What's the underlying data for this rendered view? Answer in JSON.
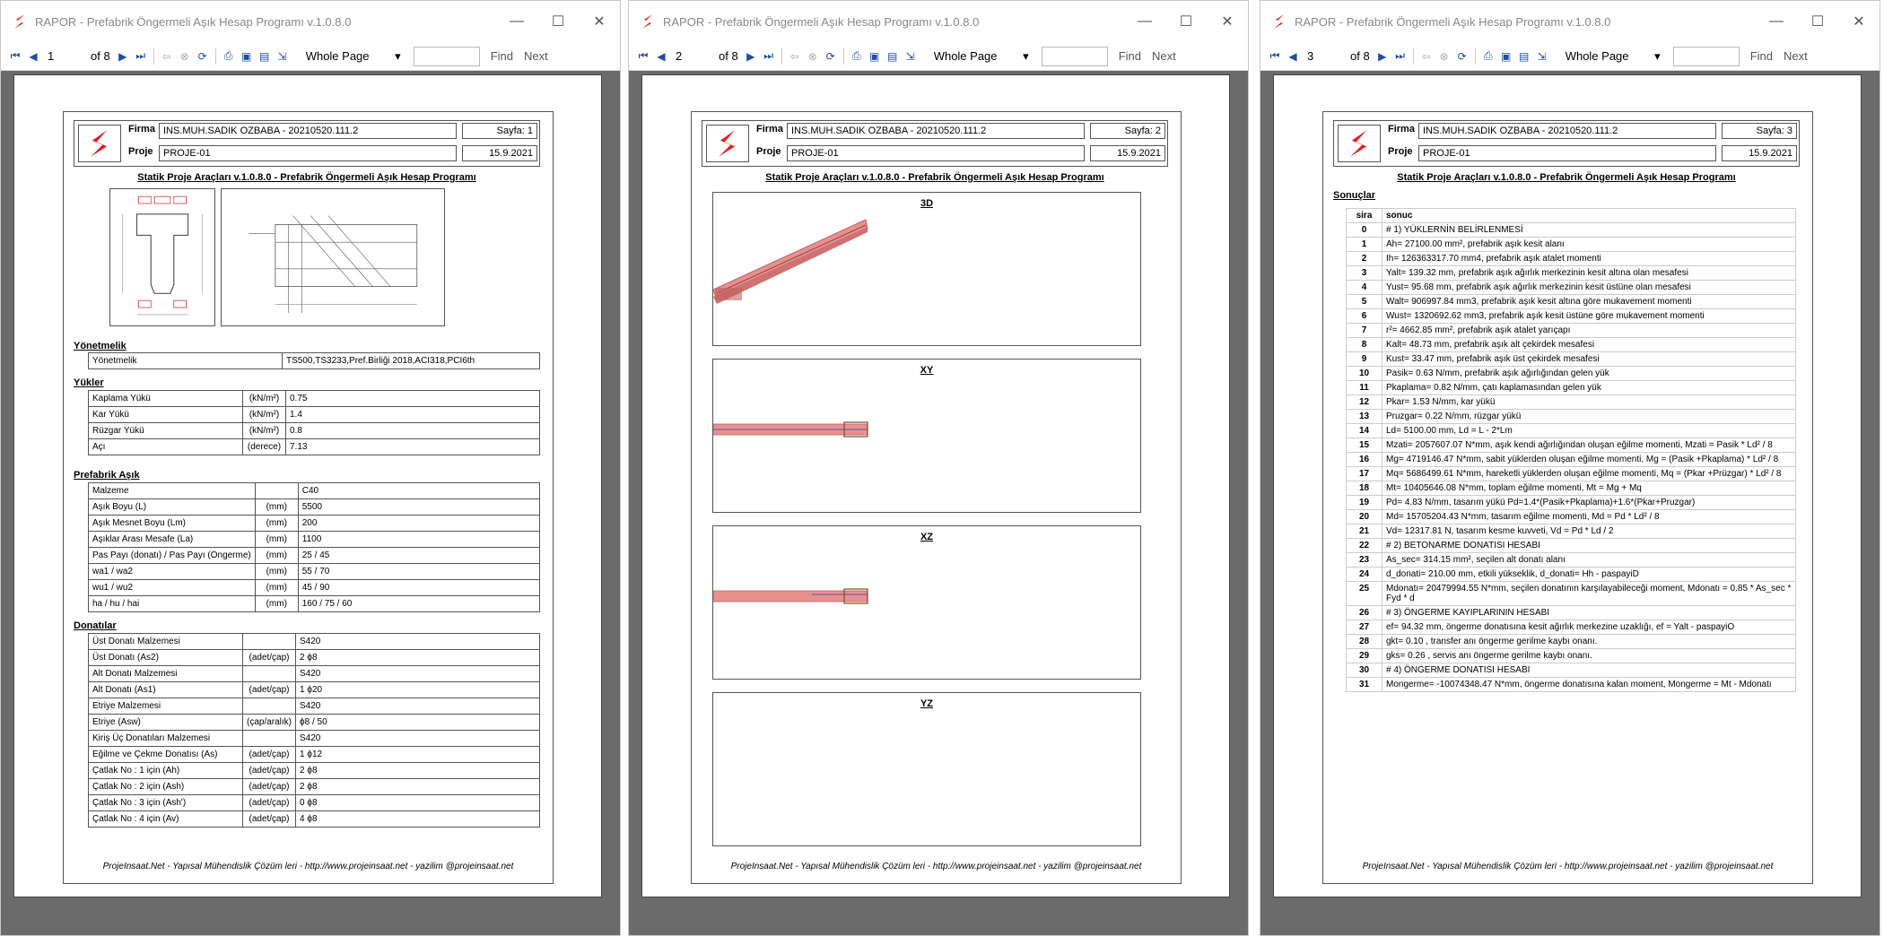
{
  "app_title": "RAPOR - Prefabrik Öngermeli Aşık Hesap Programı v.1.0.8.0",
  "toolbar": {
    "of_label": "of 8",
    "zoom": "Whole Page",
    "find": "Find",
    "next": "Next"
  },
  "pages": [
    "1",
    "2",
    "3"
  ],
  "header": {
    "firma_label": "Firma",
    "proje_label": "Proje",
    "firma_value": "INS.MUH.SADIK OZBABA                    - 20210520.111.2",
    "proje_value": "PROJE-01",
    "date": "15.9.2021",
    "sayfa1": "Sayfa: 1",
    "sayfa2": "Sayfa: 2",
    "sayfa3": "Sayfa: 3"
  },
  "subtitle": "Statik Proje Araçları v.1.0.8.0 - Prefabrik Öngermeli Aşık Hesap Programı",
  "footer": "ProjeInsaat.Net - Yapısal Mühendislik Çözüm leri - http://www.projeinsaat.net - yazilim @projeinsaat.net",
  "page1": {
    "yonetmelik_title": "Yönetmelik",
    "yonetmelik": [
      [
        "Yönetmelik",
        "TS500,TS3233,Pref.Birliği 2018,ACI318,PCI6th"
      ]
    ],
    "yukler_title": "Yükler",
    "yukler": [
      [
        "Kaplama Yükü",
        "(kN/m²)",
        "0.75"
      ],
      [
        "Kar Yükü",
        "(kN/m²)",
        "1.4"
      ],
      [
        "Rüzgar Yükü",
        "(kN/m²)",
        "0.8"
      ],
      [
        "Açı",
        "(derece)",
        "7.13"
      ]
    ],
    "asik_title": "Prefabrik Aşık",
    "asik": [
      [
        "Malzeme",
        "",
        "C40"
      ],
      [
        "Aşık Boyu (L)",
        "(mm)",
        "5500"
      ],
      [
        "Aşık Mesnet Boyu (Lm)",
        "(mm)",
        "200"
      ],
      [
        "Aşıklar Arası Mesafe (La)",
        "(mm)",
        "1100"
      ],
      [
        "Pas Payı (donatı) / Pas Payı (Ongerme)",
        "(mm)",
        "25 / 45"
      ],
      [
        "wa1 / wa2",
        "(mm)",
        "55 / 70"
      ],
      [
        "wu1 / wu2",
        "(mm)",
        "45 / 90"
      ],
      [
        "ha / hu / hai",
        "(mm)",
        "160 / 75 / 60"
      ]
    ],
    "donatilar_title": "Donatılar",
    "donatilar": [
      [
        "Üst Donatı Malzemesi",
        "",
        "S420"
      ],
      [
        "Üst Donatı (As2)",
        "(adet/çap)",
        "2 ϕ8"
      ],
      [
        "Alt Donatı Malzemesi",
        "",
        "S420"
      ],
      [
        "Alt Donatı (As1)",
        "(adet/çap)",
        "1 ϕ20"
      ],
      [
        "Etriye Malzemesi",
        "",
        "S420"
      ],
      [
        "Etriye (Asw)",
        "(çap/aralık)",
        "ϕ8 / 50"
      ],
      [
        "Kiriş Üç Donatıları Malzemesi",
        "",
        "S420"
      ],
      [
        "Eğilme ve Çekme Donatısı (As)",
        "(adet/çap)",
        "1 ϕ12"
      ],
      [
        "Çatlak No : 1 için (Ah)",
        "(adet/çap)",
        "2 ϕ8"
      ],
      [
        "Çatlak No : 2 için (Ash)",
        "(adet/çap)",
        "2 ϕ8"
      ],
      [
        "Çatlak No : 3 için (Ash')",
        "(adet/çap)",
        "0 ϕ8"
      ],
      [
        "Çatlak No : 4 için (Av)",
        "(adet/çap)",
        "4 ϕ8"
      ]
    ]
  },
  "page2": {
    "views": [
      "3D",
      "XY",
      "XZ",
      "YZ"
    ]
  },
  "page3": {
    "title": "Sonuçlar",
    "col_sira": "sira",
    "col_sonuc": "sonuc",
    "rows": [
      [
        "0",
        "# 1) YÜKLERNİN BELİRLENMESİ"
      ],
      [
        "1",
        "Ah= 27100.00 mm², prefabrik aşık kesit alanı"
      ],
      [
        "2",
        "Ih= 126363317.70 mm4, prefabrik aşık atalet momenti"
      ],
      [
        "3",
        "Yalt= 139.32 mm, prefabrik aşık ağırlık merkezinin kesit altına olan mesafesi"
      ],
      [
        "4",
        "Yust= 95.68 mm, prefabrik aşık ağırlık merkezinin kesit üstüne olan mesafesi"
      ],
      [
        "5",
        "Walt= 906997.84 mm3, prefabrik aşık kesit altına göre mukavement momenti"
      ],
      [
        "6",
        "Wust= 1320692.62 mm3, prefabrik aşık kesit üstüne göre mukavement momenti"
      ],
      [
        "7",
        "r²= 4662.85 mm², prefabrik aşık atalet yarıçapı"
      ],
      [
        "8",
        "Kalt= 48.73 mm, prefabrik aşık alt çekirdek mesafesi"
      ],
      [
        "9",
        "Kust= 33.47 mm, prefabrik aşık üst çekirdek mesafesi"
      ],
      [
        "10",
        "Pasik= 0.63 N/mm, prefabrik aşık ağırlığından gelen yük"
      ],
      [
        "11",
        "Pkaplama= 0.82 N/mm, çatı kaplamasından gelen yük"
      ],
      [
        "12",
        "Pkar= 1.53 N/mm, kar yükü"
      ],
      [
        "13",
        "Pruzgar= 0.22 N/mm, rüzgar yükü"
      ],
      [
        "14",
        "Ld= 5100.00 mm, Ld = L - 2*Lm"
      ],
      [
        "15",
        "Mzati= 2057607.07 N*mm, aşık kendi ağırlığından oluşan eğilme momenti, Mzati = Pasik * Ld² / 8"
      ],
      [
        "16",
        "Mg= 4719146.47 N*mm, sabit yüklerden oluşan eğilme momenti, Mg = (Pasik +Pkaplama) * Ld² / 8"
      ],
      [
        "17",
        "Mq= 5686499.61 N*mm, hareketli yüklerden oluşan eğilme momenti, Mq = (Pkar +Prüzgar) * Ld² / 8"
      ],
      [
        "18",
        "Mt= 10405646.08 N*mm, toplam eğilme momenti, Mt = Mg + Mq"
      ],
      [
        "19",
        "Pd= 4.83 N/mm, tasarım yükü Pd=1.4*(Pasik+Pkaplama)+1.6*(Pkar+Pruzgar)"
      ],
      [
        "20",
        "Md= 15705204.43 N*mm, tasarım eğilme momenti, Md = Pd * Ld² / 8"
      ],
      [
        "21",
        "Vd= 12317.81 N, tasarım kesme kuvveti, Vd = Pd * Ld / 2"
      ],
      [
        "22",
        "# 2) BETONARME DONATISI HESABI"
      ],
      [
        "23",
        "As_sec= 314.15 mm², seçilen alt donatı alanı"
      ],
      [
        "24",
        "d_donati= 210.00 mm, etkili yükseklik, d_donati= Hh - paspayiD"
      ],
      [
        "25",
        "Mdonatı= 20479994.55 N*mm, seçilen donatının karşılayabileceği moment, Mdonatı = 0.85 * As_sec * Fyd * d"
      ],
      [
        "26",
        "# 3) ÖNGERME KAYIPLARININ HESABI"
      ],
      [
        "27",
        "ef= 94.32 mm, öngerme donatısına kesit ağırlık merkezine uzaklığı, ef = Yalt - paspayiO"
      ],
      [
        "28",
        "gkt= 0.10 , transfer anı öngerme gerilme kaybı onanı."
      ],
      [
        "29",
        "gks= 0.26 , servis anı öngerme gerilme kaybı onanı."
      ],
      [
        "30",
        "# 4) ÖNGERME DONATISI HESABI"
      ],
      [
        "31",
        "Mongerme= -10074348.47 N*mm, öngerme donatısına kalan moment, Mongerme = Mt - Mdonatı"
      ]
    ]
  },
  "colors": {
    "logo_red": "#e02020",
    "viewer_bg": "#6b6b6b",
    "beam_pink": "#e89090",
    "beam_dark": "#c06060"
  }
}
